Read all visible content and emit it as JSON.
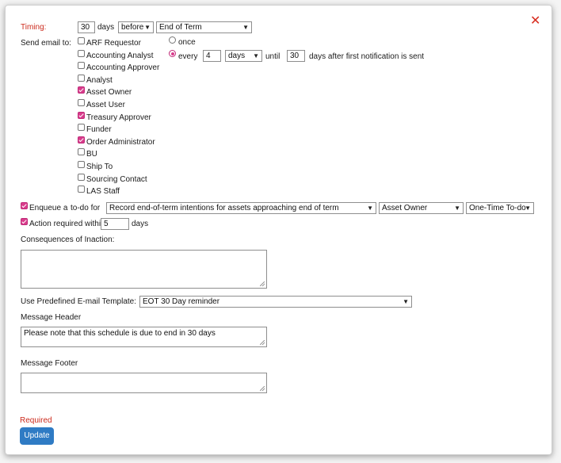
{
  "close_glyph": "✕",
  "timing": {
    "label": "Timing:",
    "days_value": "30",
    "days_label": "days",
    "relation_selected": "before",
    "event_selected": "End of Term"
  },
  "send_email": {
    "label": "Send email to:",
    "recipients": [
      {
        "label": "ARF Requestor",
        "checked": false
      },
      {
        "label": "Accounting Analyst",
        "checked": false
      },
      {
        "label": "Accounting Approver",
        "checked": false
      },
      {
        "label": "Analyst",
        "checked": false
      },
      {
        "label": "Asset Owner",
        "checked": true
      },
      {
        "label": "Asset User",
        "checked": false
      },
      {
        "label": "Treasury Approver",
        "checked": true
      },
      {
        "label": "Funder",
        "checked": false
      },
      {
        "label": "Order Administrator",
        "checked": true
      },
      {
        "label": "BU",
        "checked": false
      },
      {
        "label": "Ship To",
        "checked": false
      },
      {
        "label": "Sourcing Contact",
        "checked": false
      },
      {
        "label": "LAS Staff",
        "checked": false
      }
    ],
    "frequency": {
      "once_label": "once",
      "once_selected": false,
      "every_label": "every",
      "every_selected": true,
      "interval_value": "4",
      "interval_unit_selected": "days",
      "until_label": "until",
      "until_value": "30",
      "suffix_label": "days after first notification is sent"
    }
  },
  "enqueue": {
    "checked": true,
    "label_prefix": "Enqueue a",
    "label_suffix": "to-do for",
    "todo_selected": "Record end-of-term intentions for assets approaching end of term",
    "role_selected": "Asset Owner",
    "type_selected": "One-Time To-do"
  },
  "action_required": {
    "checked": true,
    "label": "Action required within",
    "value": "5",
    "unit": "days"
  },
  "consequences": {
    "label": "Consequences of Inaction:",
    "value": ""
  },
  "template": {
    "label": "Use Predefined E-mail Template:",
    "selected": "EOT 30 Day reminder"
  },
  "message_header": {
    "label": "Message Header",
    "value": "Please note that this schedule is due to end in 30 days"
  },
  "message_footer": {
    "label": "Message Footer",
    "value": ""
  },
  "required_label": "Required",
  "update_button": "Update",
  "colors": {
    "accent_red": "#cc2b1d",
    "checkbox_pink": "#d93c8c",
    "button_blue": "#2f7bc4"
  }
}
